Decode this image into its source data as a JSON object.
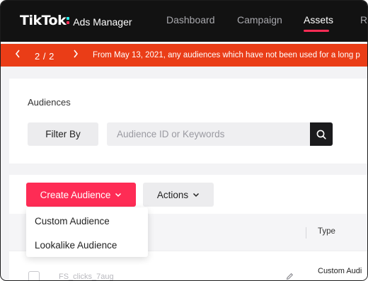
{
  "brand": {
    "logo_text": "TikTok",
    "product": "Ads Manager"
  },
  "nav": {
    "items": [
      {
        "label": "Dashboard"
      },
      {
        "label": "Campaign"
      },
      {
        "label": "Assets"
      },
      {
        "label": "Re"
      }
    ],
    "active_index": 2
  },
  "banner": {
    "pager": "2 / 2",
    "text": "From May 13, 2021, any audiences which have not been used for a long p"
  },
  "filter": {
    "title": "Audiences",
    "filter_label": "Filter By",
    "search_placeholder": "Audience ID or Keywords"
  },
  "toolbar": {
    "create_label": "Create Audience",
    "actions_label": "Actions"
  },
  "dropdown": {
    "items": [
      {
        "label": "Custom Audience"
      },
      {
        "label": "Lookalike Audience"
      }
    ]
  },
  "table": {
    "columns": {
      "type": "Type"
    },
    "rows": [
      {
        "name": "FS_clicks_7aug",
        "type": "Custom Audi"
      }
    ]
  },
  "colors": {
    "nav_bg": "#121212",
    "accent": "#fe2c55",
    "banner_bg": "#ea3d17",
    "page_bg": "#f3f3f5"
  },
  "icons": [
    "chevron-left-icon",
    "chevron-right-icon",
    "search-icon",
    "chevron-down-icon",
    "pencil-icon"
  ]
}
